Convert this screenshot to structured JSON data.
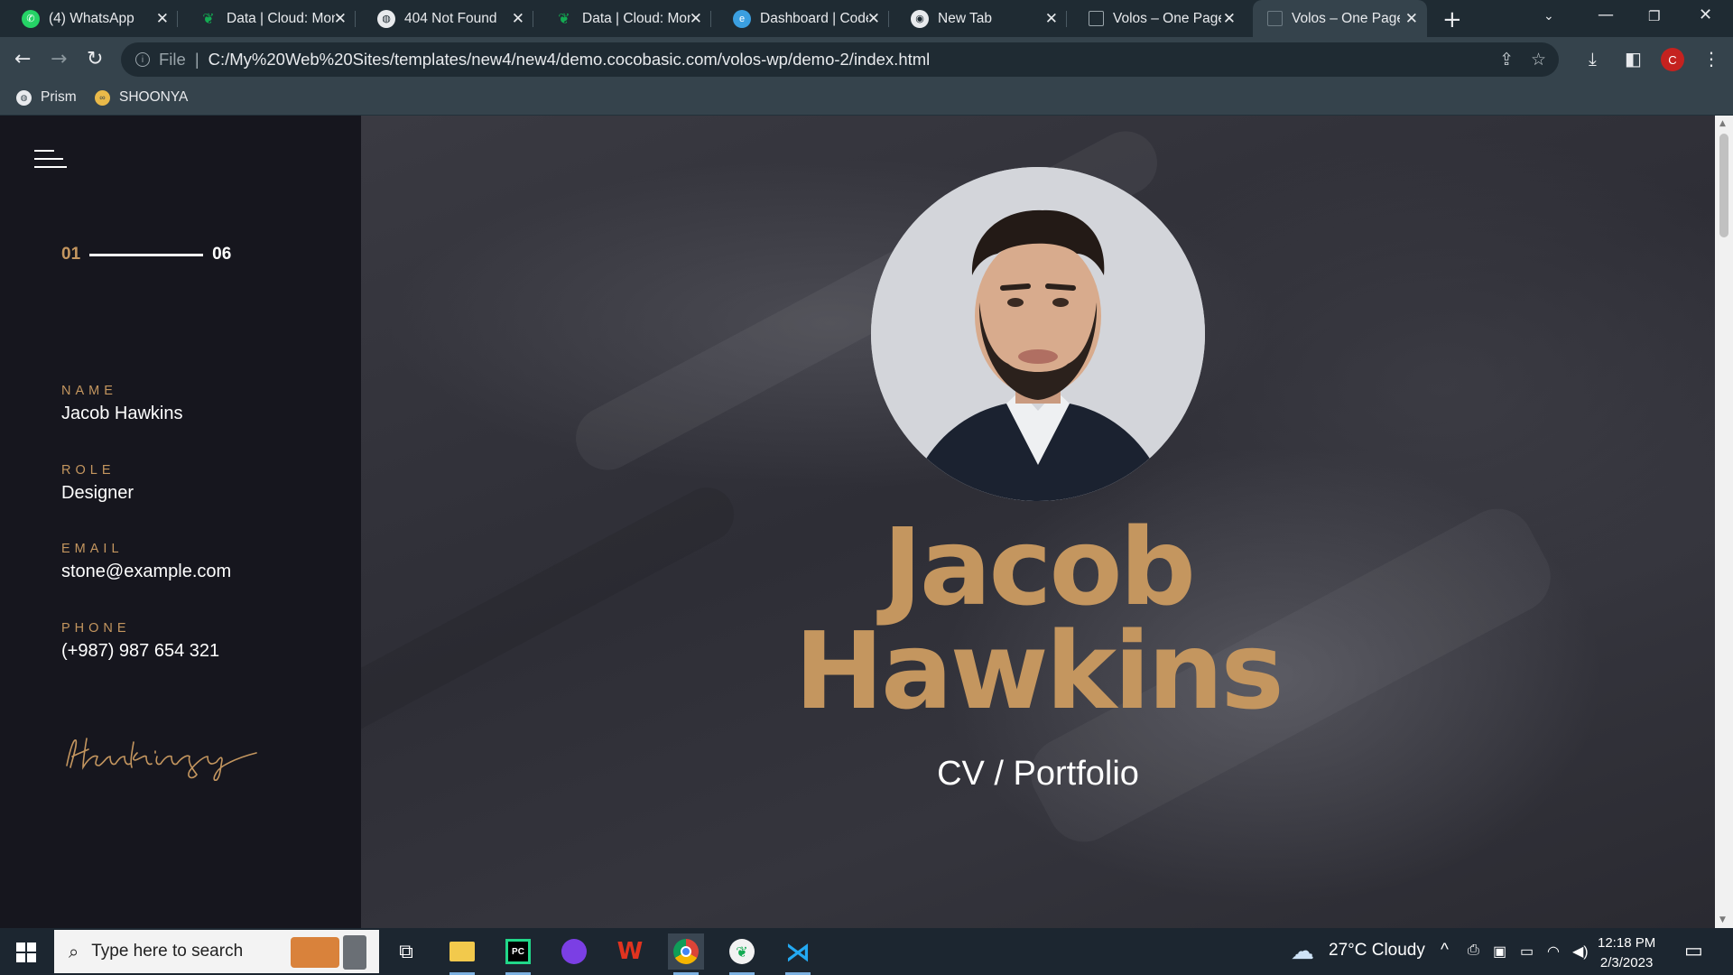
{
  "browser": {
    "tabs": [
      {
        "title": "(4) WhatsApp",
        "icon": "whatsapp-icon"
      },
      {
        "title": "Data | Cloud: Mon",
        "icon": "mongodb-leaf-icon"
      },
      {
        "title": "404 Not Found",
        "icon": "globe-icon"
      },
      {
        "title": "Data | Cloud: Mon",
        "icon": "mongodb-leaf-icon"
      },
      {
        "title": "Dashboard | Code",
        "icon": "edge-icon"
      },
      {
        "title": "New Tab",
        "icon": "chrome-icon"
      },
      {
        "title": "Volos – One Page",
        "icon": "page-icon"
      },
      {
        "title": "Volos – One Page",
        "icon": "page-icon",
        "active": true
      }
    ],
    "address": {
      "scheme_label": "File",
      "url": "C:/My%20Web%20Sites/templates/new4/new4/demo.cocobasic.com/volos-wp/demo-2/index.html"
    },
    "profile_initial": "C",
    "bookmarks": [
      {
        "label": "Prism",
        "icon": "globe-icon"
      },
      {
        "label": "SHOONYA",
        "icon": "shoonya-icon"
      }
    ]
  },
  "sidebar": {
    "counter": {
      "current": "01",
      "total": "06"
    },
    "info": [
      {
        "label": "NAME",
        "value": "Jacob Hawkins"
      },
      {
        "label": "ROLE",
        "value": "Designer"
      },
      {
        "label": "EMAIL",
        "value": "stone@example.com"
      },
      {
        "label": "PHONE",
        "value": "(+987) 987 654 321"
      }
    ],
    "signature": "Hawkings"
  },
  "hero": {
    "first_name": "Jacob",
    "last_name": "Hawkins",
    "subtitle": "CV / Portfolio"
  },
  "taskbar": {
    "search_placeholder": "Type here to search",
    "weather": "27°C  Cloudy",
    "time": "12:18 PM",
    "date": "2/3/2023"
  },
  "colors": {
    "accent_gold": "#c4965f",
    "sidebar_bg": "#16161e",
    "chrome_dark": "#1f2b33",
    "chrome_toolbar": "#35434c"
  }
}
